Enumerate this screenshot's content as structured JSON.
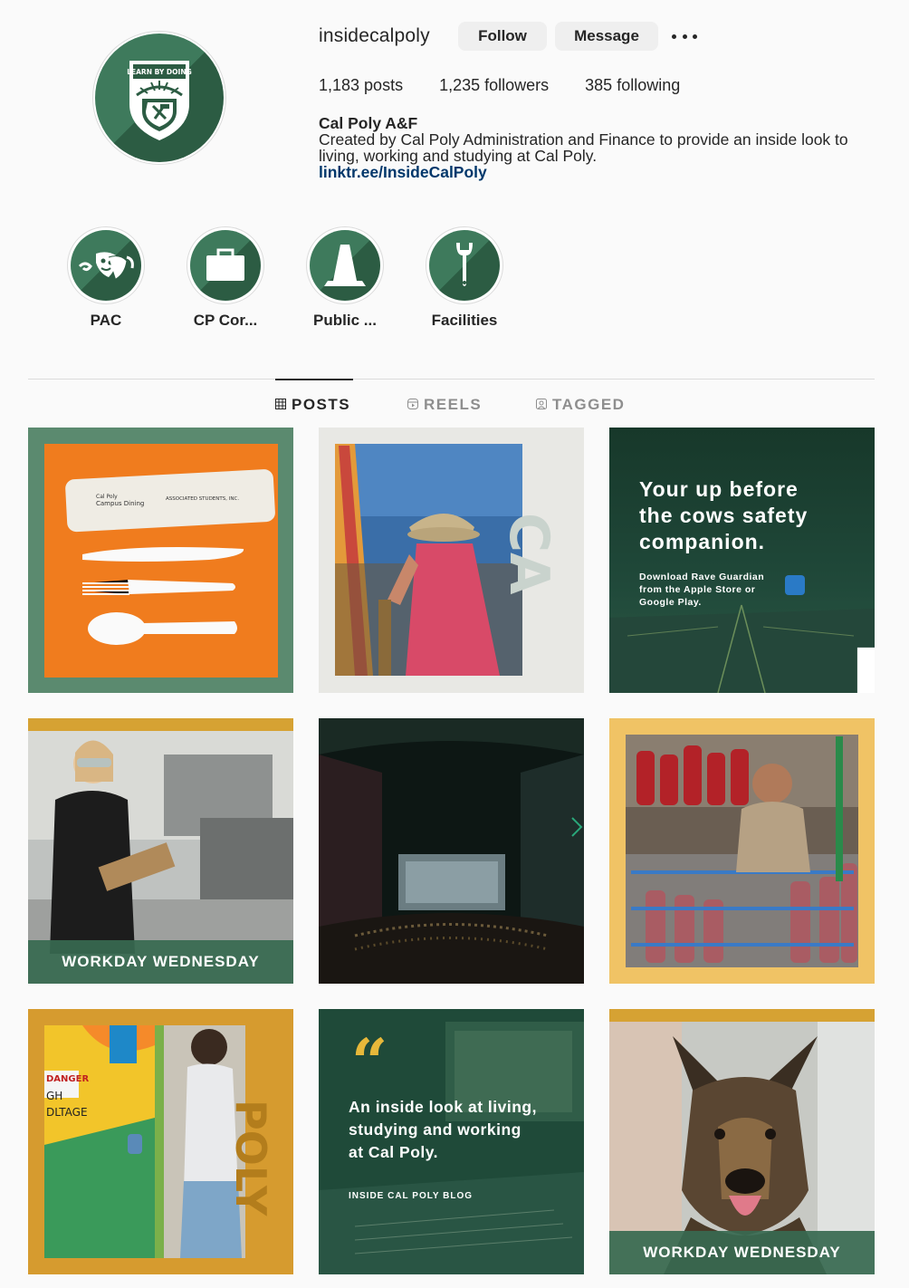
{
  "profile": {
    "username": "insidecalpoly",
    "follow_label": "Follow",
    "message_label": "Message",
    "more_icon": "more-horizontal-icon",
    "avatar_text": "LEARN BY DOING",
    "stats": {
      "posts": "1,183 posts",
      "followers": "1,235 followers",
      "following": "385 following"
    },
    "bio": {
      "name": "Cal Poly A&F",
      "text": "Created by Cal Poly Administration and Finance to provide an inside look to living, working and studying at Cal Poly.",
      "link": "linktr.ee/InsideCalPoly"
    }
  },
  "highlights": [
    {
      "label": "PAC",
      "icon": "theater-masks-icon"
    },
    {
      "label": "CP Cor...",
      "icon": "briefcase-icon"
    },
    {
      "label": "Public ...",
      "icon": "traffic-cone-icon"
    },
    {
      "label": "Facilities",
      "icon": "wrench-icon"
    }
  ],
  "tabs": [
    {
      "label": "POSTS",
      "icon": "grid-icon",
      "active": true
    },
    {
      "label": "REELS",
      "icon": "reels-icon",
      "active": false
    },
    {
      "label": "TAGGED",
      "icon": "tagged-icon",
      "active": false
    }
  ],
  "posts": [
    {
      "kind": "cutlery",
      "bag_line1": "Cal Poly",
      "bag_line2": "Campus Dining",
      "bag_line3": "ASSOCIATED STUDENTS, INC."
    },
    {
      "kind": "photo",
      "side_text": "CA"
    },
    {
      "kind": "promo",
      "headline_1": "Your up before",
      "headline_2": "the cows safety",
      "headline_3": "companion.",
      "sub_1": "Download Rave Guardian",
      "sub_2": "from the Apple Store or",
      "sub_3": "Google Play."
    },
    {
      "kind": "workday",
      "band": "WORKDAY WEDNESDAY"
    },
    {
      "kind": "theater"
    },
    {
      "kind": "extinguishers"
    },
    {
      "kind": "mural",
      "side_text": "POLY",
      "sign_1": "DANGER",
      "sign_2": "GH",
      "sign_3": "DLTAGE"
    },
    {
      "kind": "blog",
      "quote": "“",
      "line_1": "An inside look at living,",
      "line_2": "studying and working",
      "line_3": "at Cal Poly.",
      "tag": "INSIDE CAL POLY BLOG"
    },
    {
      "kind": "dog",
      "band": "WORKDAY WEDNESDAY"
    }
  ],
  "colors": {
    "brand_green": "#2c5c43",
    "brand_green_light": "#3e7a5c",
    "gold": "#d6a233",
    "orange": "#f07c1e",
    "link": "#00376b"
  }
}
